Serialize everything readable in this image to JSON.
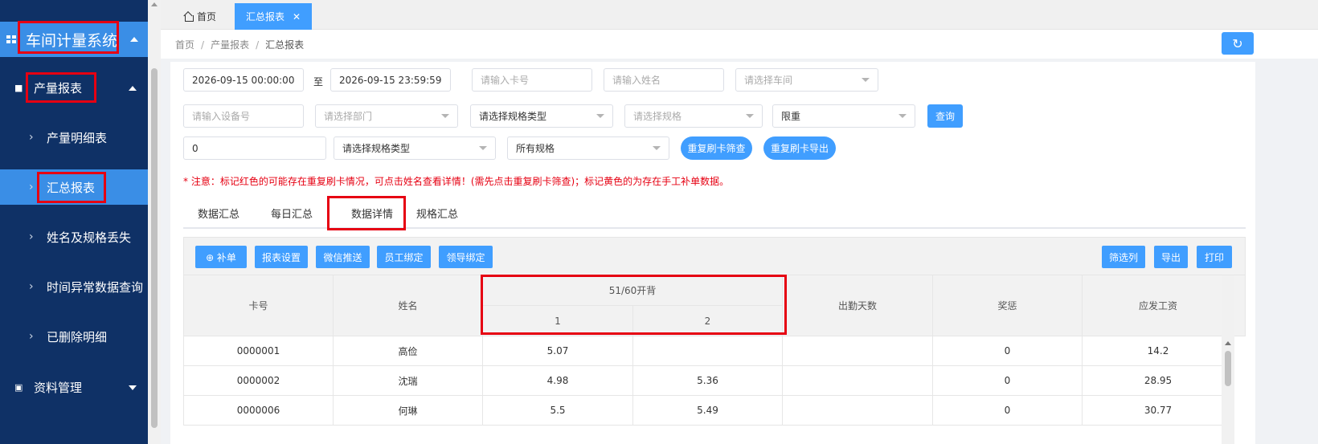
{
  "sidebar": {
    "app_title": "车间计量系统",
    "groups": [
      {
        "label": "产量报表",
        "expanded": true
      },
      {
        "label": "资料管理",
        "expanded": false
      }
    ],
    "items": [
      {
        "label": "产量明细表"
      },
      {
        "label": "汇总报表",
        "active": true
      },
      {
        "label": "姓名及规格丢失"
      },
      {
        "label": "时间异常数据查询"
      },
      {
        "label": "已删除明细"
      }
    ]
  },
  "tabs": {
    "home_label": "首页",
    "active_label": "汇总报表",
    "close_glyph": "✕"
  },
  "breadcrumb": {
    "items": [
      "首页",
      "产量报表",
      "汇总报表"
    ],
    "sep": "/"
  },
  "filters": {
    "start_time": "2026-09-15 00:00:00",
    "to_label": "至",
    "end_time": "2026-09-15 23:59:59",
    "card_ph": "请输入卡号",
    "name_ph": "请输入姓名",
    "workshop_ph": "请选择车间",
    "device_ph": "请输入设备号",
    "dept_ph": "请选择部门",
    "spec_type_1": "请选择规格类型",
    "spec_ph": "请选择规格",
    "limit_weight": "限重",
    "query_label": "查询",
    "num_value": "0",
    "spec_type_2": "请选择规格类型",
    "all_specs": "所有规格",
    "dup_filter_label": "重复刷卡筛查",
    "dup_export_label": "重复刷卡导出"
  },
  "notice": "* 注意：标记红色的可能存在重复刷卡情况，可点击姓名查看详情！(需先点击重复刷卡筛查)；标记黄色的为存在手工补单数据。",
  "subtabs": [
    "数据汇总",
    "每日汇总",
    "数据详情",
    "规格汇总"
  ],
  "toolbar": {
    "left": [
      "⊕ 补单",
      "报表设置",
      "微信推送",
      "员工绑定",
      "领导绑定"
    ],
    "right": [
      "筛选列",
      "导出",
      "打印"
    ]
  },
  "table": {
    "headers": {
      "card": "卡号",
      "name": "姓名",
      "group": "51/60开背",
      "sub1": "1",
      "sub2": "2",
      "days": "出勤天数",
      "bonus": "奖惩",
      "wage": "应发工资"
    },
    "rows": [
      {
        "card": "0000001",
        "name": "高俭",
        "v1": "5.07",
        "v2": "",
        "days": "",
        "bonus": "0",
        "wage": "14.2"
      },
      {
        "card": "0000002",
        "name": "沈瑞",
        "v1": "4.98",
        "v2": "5.36",
        "days": "",
        "bonus": "0",
        "wage": "28.95"
      },
      {
        "card": "0000006",
        "name": "何琳",
        "v1": "5.5",
        "v2": "5.49",
        "days": "",
        "bonus": "0",
        "wage": "30.77"
      }
    ]
  },
  "colors": {
    "sidebar_bg": "#0f3166",
    "accent": "#409eff",
    "highlight_red": "#e60012"
  }
}
